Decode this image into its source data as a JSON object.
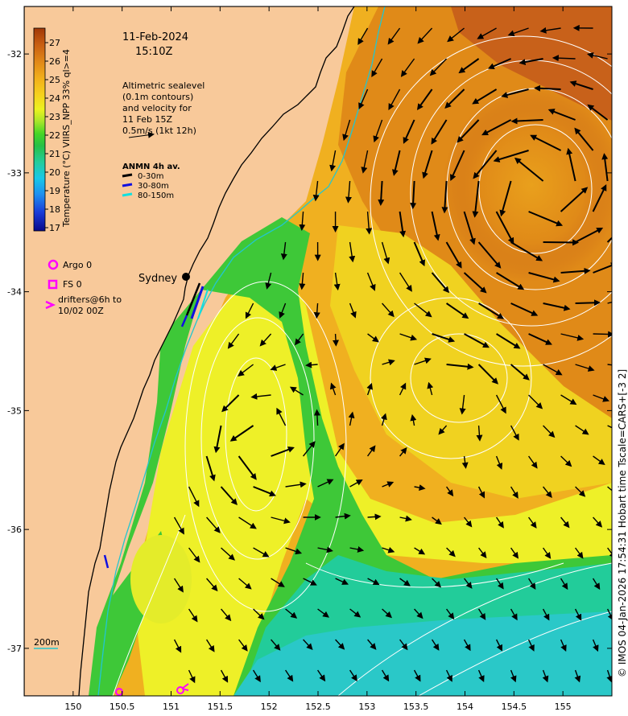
{
  "title": {
    "date": "11-Feb-2024",
    "time": "15:10Z"
  },
  "colorbar": {
    "label": "Temperature (°C) VIIRS_NPP 33% ql>=4",
    "ticks": [
      "27",
      "26",
      "25",
      "24",
      "23",
      "22",
      "21",
      "20",
      "19",
      "18",
      "17"
    ],
    "range": [
      17,
      27
    ],
    "colors": [
      "#08088a",
      "#1a3ad8",
      "#1e8ff0",
      "#18c8e8",
      "#22cc9a",
      "#26c046",
      "#46d626",
      "#a8e62a",
      "#ecf220",
      "#f6d21c",
      "#f2b01a",
      "#e28a18",
      "#c85e12",
      "#a03808"
    ]
  },
  "altimetry_note": [
    "Altimetric sealevel",
    "(0.1m contours)",
    "and velocity for",
    "11 Feb 15Z",
    "0.5m/s (1kt 12h)"
  ],
  "anmn_legend": {
    "title": "ANMN 4h av.",
    "items": [
      {
        "label": "0-30m",
        "color": "#000000"
      },
      {
        "label": "30-80m",
        "color": "#1010e0"
      },
      {
        "label": "80-150m",
        "color": "#10e0e0"
      }
    ]
  },
  "markers": {
    "argo": "Argo 0",
    "fs": "FS 0",
    "drifters": [
      "drifters@6h to",
      "10/02 00Z"
    ],
    "color": "#ff00ff"
  },
  "place_label": "Sydney",
  "scale_bar": "200m",
  "x_ticks": [
    "150",
    "150.5",
    "151",
    "151.5",
    "152",
    "152.5",
    "153",
    "153.5",
    "154",
    "154.5",
    "155"
  ],
  "y_ticks": [
    "-32",
    "-33",
    "-34",
    "-35",
    "-36",
    "-37"
  ],
  "map_extent": {
    "lon": [
      149.5,
      155.5
    ],
    "lat": [
      -37.4,
      -31.6
    ]
  },
  "credit": "© IMOS 04-Jan-2026 17:54:31 Hobart time Tscale=CARS+[-3 2]",
  "colors": {
    "land": "#f8c99a",
    "coast": "#000000",
    "contour": "#ffffff",
    "arrow": "#000000",
    "shelf_line": "#22c6d0"
  }
}
